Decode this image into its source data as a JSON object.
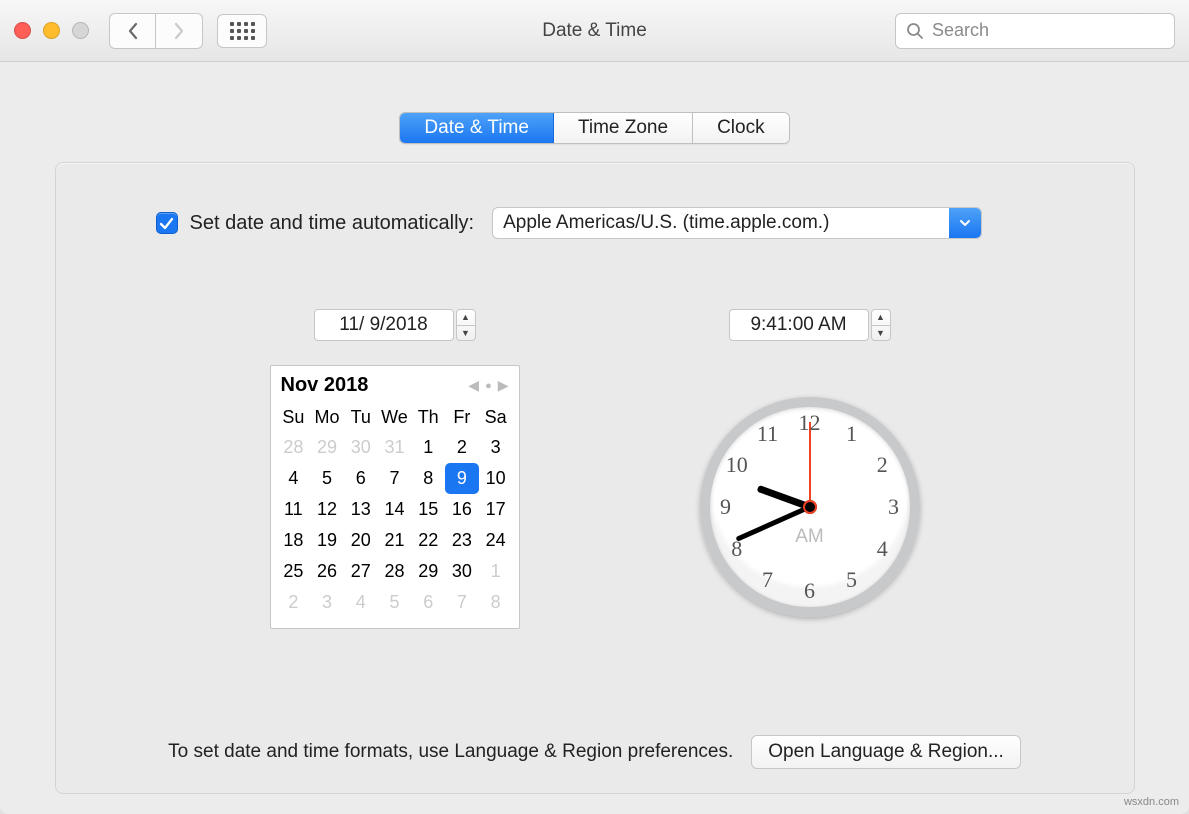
{
  "window": {
    "title": "Date & Time"
  },
  "search": {
    "placeholder": "Search"
  },
  "tabs": {
    "date_time": "Date & Time",
    "time_zone": "Time Zone",
    "clock": "Clock"
  },
  "auto": {
    "label": "Set date and time automatically:",
    "server": "Apple Americas/U.S. (time.apple.com.)"
  },
  "date": {
    "value": "11/  9/2018"
  },
  "time": {
    "value": "9:41:00 AM"
  },
  "calendar": {
    "title": "Nov 2018",
    "dow": [
      "Su",
      "Mo",
      "Tu",
      "We",
      "Th",
      "Fr",
      "Sa"
    ],
    "days": [
      {
        "n": "28",
        "out": true
      },
      {
        "n": "29",
        "out": true
      },
      {
        "n": "30",
        "out": true
      },
      {
        "n": "31",
        "out": true
      },
      {
        "n": "1"
      },
      {
        "n": "2"
      },
      {
        "n": "3"
      },
      {
        "n": "4"
      },
      {
        "n": "5"
      },
      {
        "n": "6"
      },
      {
        "n": "7"
      },
      {
        "n": "8"
      },
      {
        "n": "9",
        "sel": true
      },
      {
        "n": "10"
      },
      {
        "n": "11"
      },
      {
        "n": "12"
      },
      {
        "n": "13"
      },
      {
        "n": "14"
      },
      {
        "n": "15"
      },
      {
        "n": "16"
      },
      {
        "n": "17"
      },
      {
        "n": "18"
      },
      {
        "n": "19"
      },
      {
        "n": "20"
      },
      {
        "n": "21"
      },
      {
        "n": "22"
      },
      {
        "n": "23"
      },
      {
        "n": "24"
      },
      {
        "n": "25"
      },
      {
        "n": "26"
      },
      {
        "n": "27"
      },
      {
        "n": "28"
      },
      {
        "n": "29"
      },
      {
        "n": "30"
      },
      {
        "n": "1",
        "out": true
      },
      {
        "n": "2",
        "out": true
      },
      {
        "n": "3",
        "out": true
      },
      {
        "n": "4",
        "out": true
      },
      {
        "n": "5",
        "out": true
      },
      {
        "n": "6",
        "out": true
      },
      {
        "n": "7",
        "out": true
      },
      {
        "n": "8",
        "out": true
      }
    ]
  },
  "clock": {
    "numbers": [
      "12",
      "1",
      "2",
      "3",
      "4",
      "5",
      "6",
      "7",
      "8",
      "9",
      "10",
      "11"
    ],
    "ampm": "AM",
    "hour_angle": 290,
    "minute_angle": 246,
    "second_angle": 0
  },
  "footer": {
    "hint": "To set date and time formats, use Language & Region preferences.",
    "button": "Open Language & Region..."
  },
  "watermark": "wsxdn.com"
}
